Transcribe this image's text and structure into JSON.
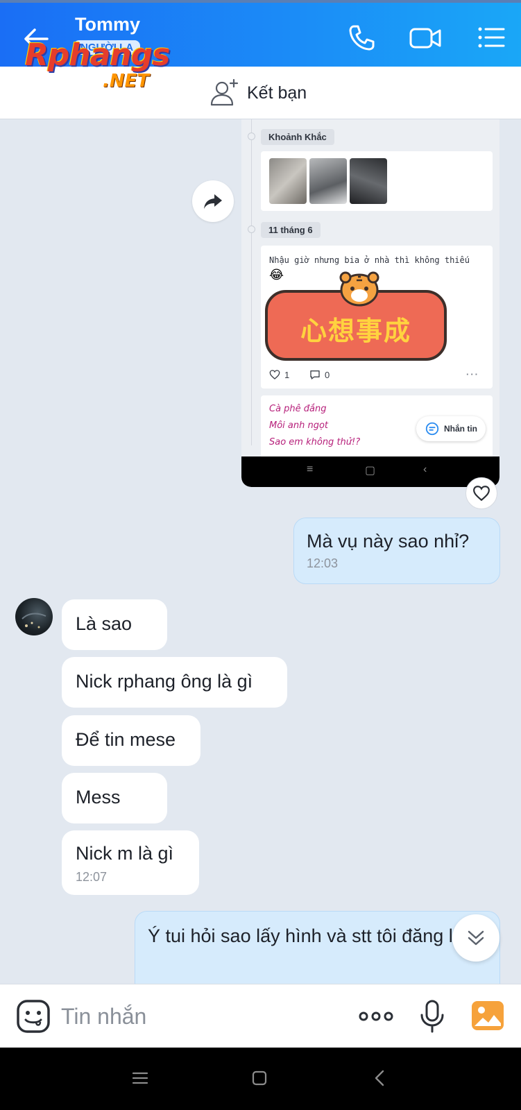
{
  "header": {
    "contact_name": "Tommy",
    "contact_badge": "NGƯỜI LẠ",
    "icons": [
      "back-arrow-icon",
      "phone-icon",
      "video-call-icon",
      "menu-list-icon"
    ],
    "background": "#1b8bf7"
  },
  "watermark": {
    "main": "Rphangs",
    "sub": ".NET"
  },
  "add_friend": {
    "label": "Kết bạn"
  },
  "shared_screenshot": {
    "section1_label": "Khoảnh Khắc",
    "section2_label": "11 tháng 6",
    "post_text": "Nhậu giờ nhưng bia ở nhà thì không thiếu",
    "post_emoji": "😂",
    "sticker_text": "心想事成",
    "likes": "1",
    "comments": "0",
    "poem_lines": [
      "Cà phê đắng",
      "Môi anh ngọt",
      "Sao em không thử!?"
    ],
    "message_button": "Nhắn tin"
  },
  "messages": [
    {
      "direction": "out",
      "text": "Mà vụ này sao nhỉ?",
      "time": "12:03"
    },
    {
      "direction": "in",
      "text": "Là sao"
    },
    {
      "direction": "in",
      "text": "Nick rphang ông là gì"
    },
    {
      "direction": "in",
      "text": "Để tin mese"
    },
    {
      "direction": "in",
      "text": "Mess"
    },
    {
      "direction": "in",
      "text": "Nick m là gì",
      "time": "12:07"
    },
    {
      "direction": "out",
      "text": "Ý tui hỏi sao lấy hình và stt tôi đăng lại?"
    }
  ],
  "composer": {
    "placeholder": "Tin nhắn"
  },
  "colors": {
    "accent": "#1b8bf7",
    "outgoing_bubble": "#d6ebfc",
    "chat_bg": "#e2e8f0"
  }
}
